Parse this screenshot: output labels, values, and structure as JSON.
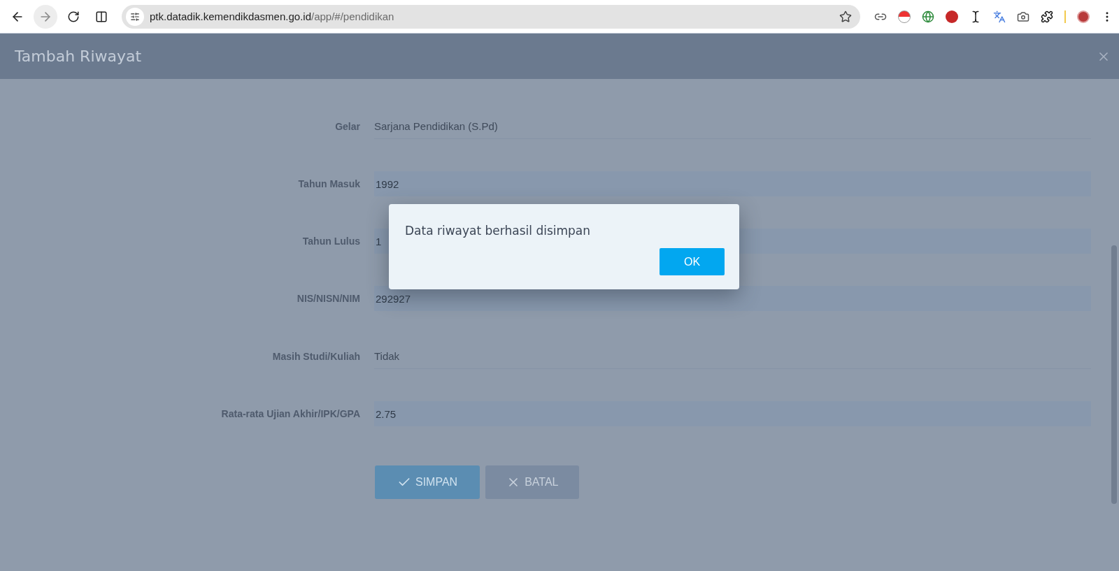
{
  "browser": {
    "nav": [
      {
        "kind": "back",
        "disabled": false
      },
      {
        "kind": "forward",
        "disabled": true
      },
      {
        "kind": "reload",
        "disabled": false
      },
      {
        "kind": "split",
        "disabled": false
      }
    ],
    "url": {
      "host": "ptk.datadik.kemendikdasmen.go.id",
      "path": "/app/#/pendidikan"
    },
    "extensions": [
      {
        "kind": "link"
      },
      {
        "kind": "ball"
      },
      {
        "kind": "globe"
      },
      {
        "kind": "letter"
      },
      {
        "kind": "cursor"
      },
      {
        "kind": "translate"
      },
      {
        "kind": "camera"
      },
      {
        "kind": "puzzle"
      },
      {
        "kind": "divider"
      },
      {
        "kind": "avatar"
      },
      {
        "kind": "menu"
      }
    ]
  },
  "modal": {
    "title": "Tambah Riwayat",
    "fields": [
      {
        "label": "Gelar",
        "value": "Sarjana Pendidikan (S.Pd)",
        "kind": "text"
      },
      {
        "label": "Tahun Masuk",
        "value": "1992",
        "kind": "input"
      },
      {
        "label": "Tahun Lulus",
        "value": "1",
        "kind": "input"
      },
      {
        "label": "NIS/NISN/NIM",
        "value": "292927",
        "kind": "input"
      },
      {
        "label": "Masih Studi/Kuliah",
        "value": "Tidak",
        "kind": "text"
      },
      {
        "label": "Rata-rata Ujian Akhir/IPK/GPA",
        "value": "2.75",
        "kind": "input"
      }
    ],
    "buttons": [
      {
        "label": "SIMPAN",
        "kind": "primary"
      },
      {
        "label": "BATAL",
        "kind": "secondary"
      }
    ]
  },
  "alert": {
    "message": "Data riwayat berhasil disimpan",
    "button": "OK"
  }
}
